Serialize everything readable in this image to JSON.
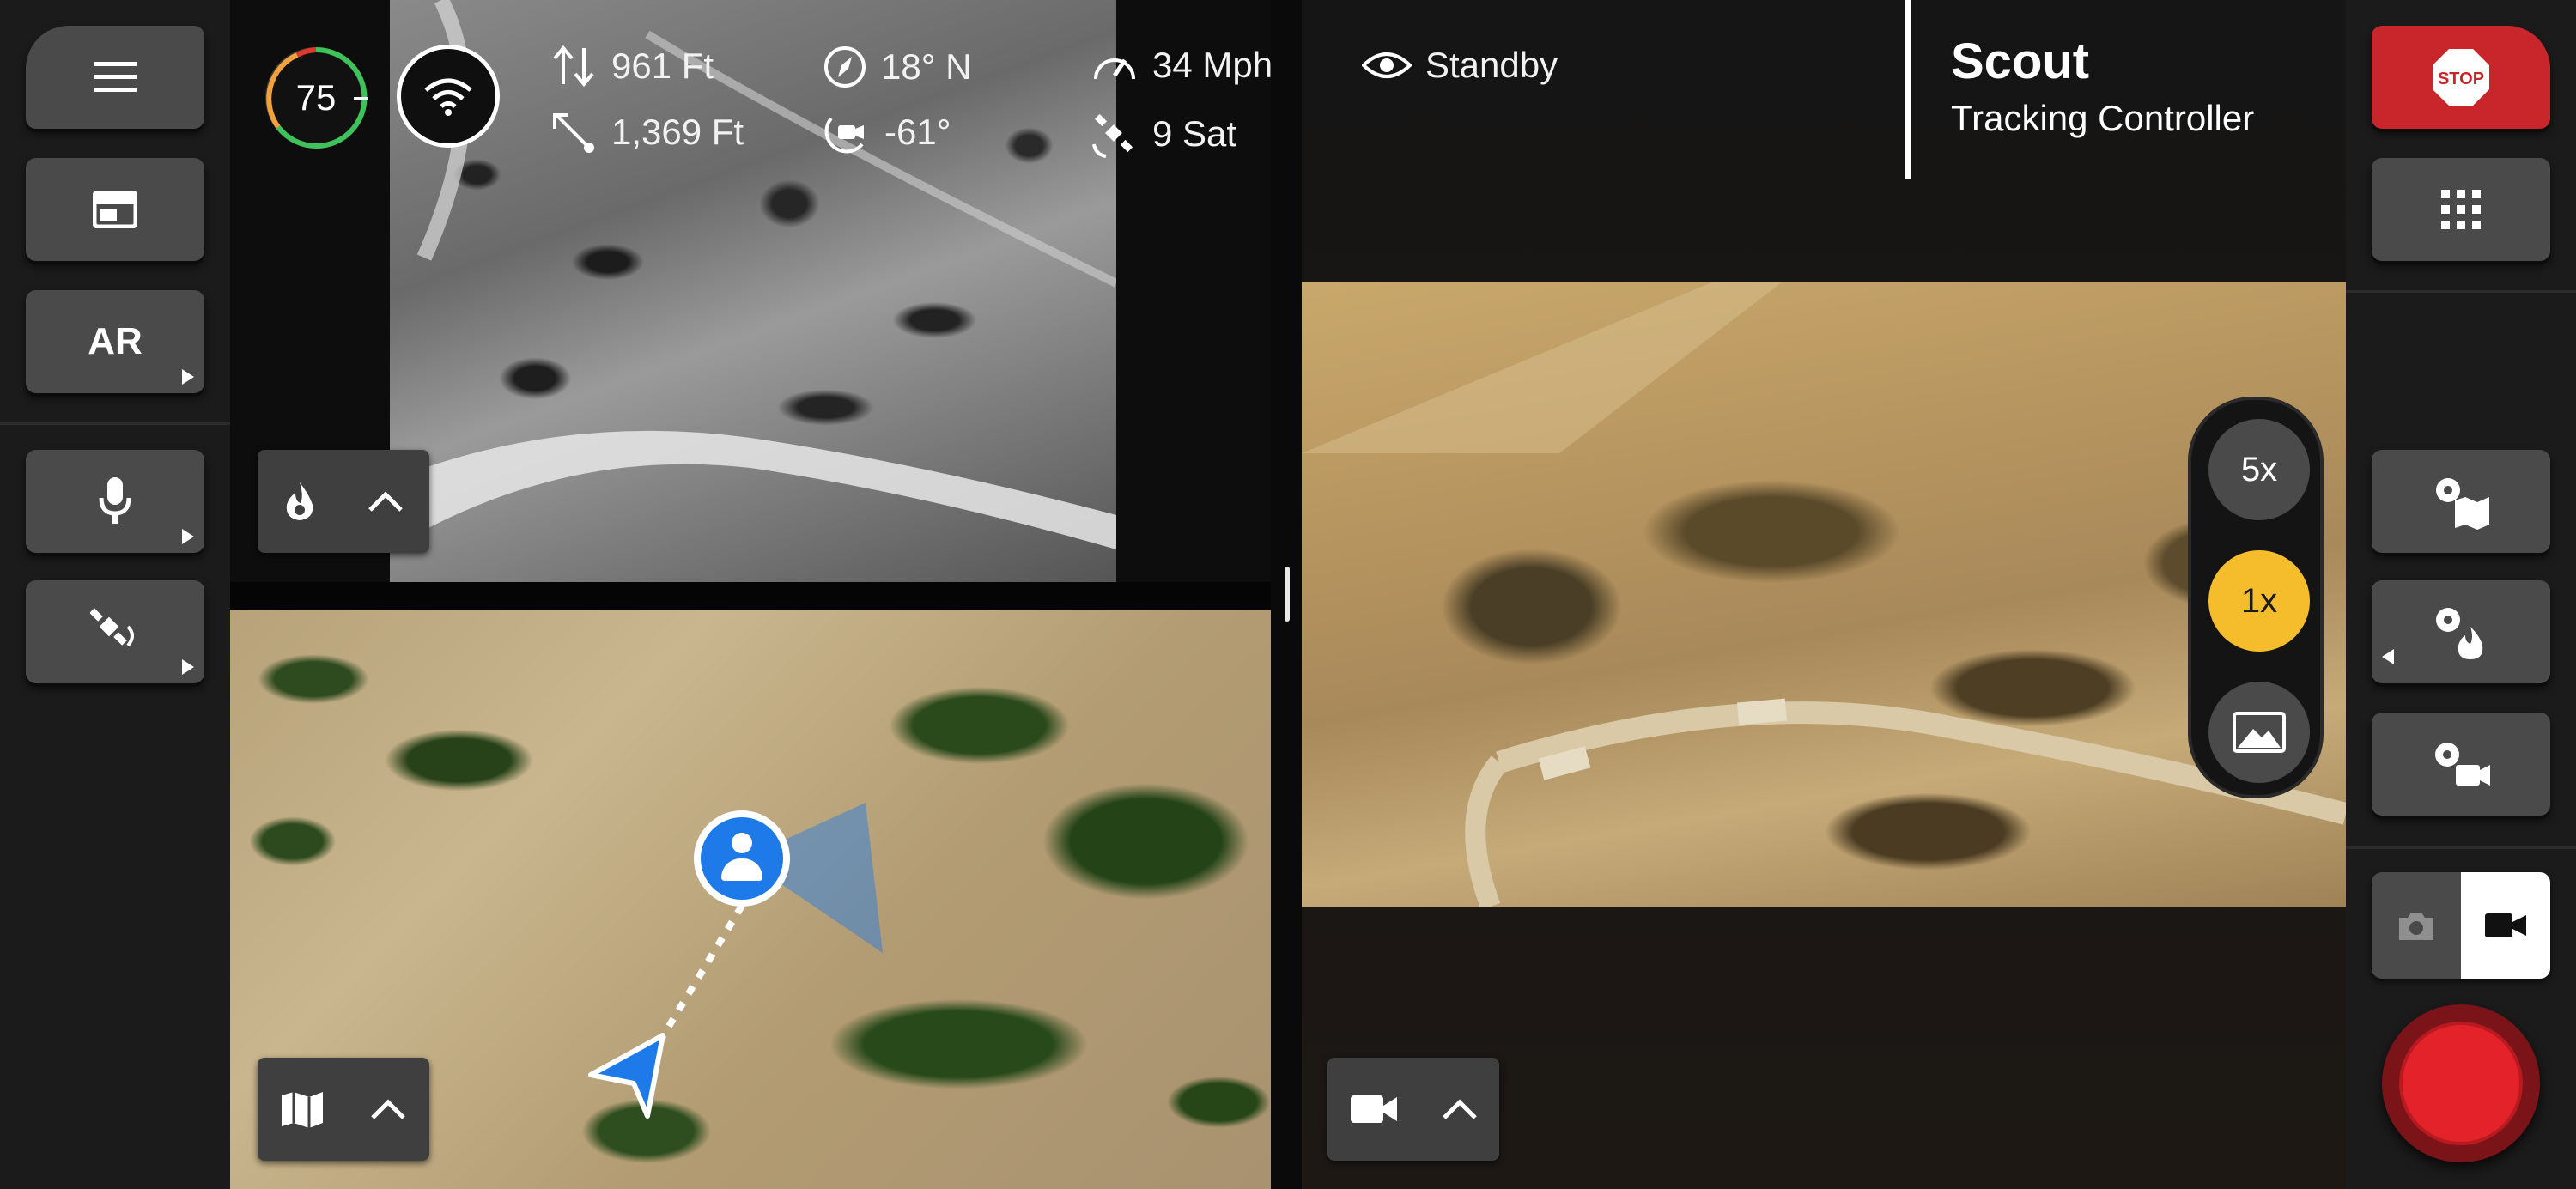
{
  "left_rail": {
    "menu_icon": "hamburger-menu-icon",
    "layout_icon": "layout-window-icon",
    "ar_label": "AR",
    "mic_icon": "microphone-icon",
    "satellite_icon": "satellite-icon"
  },
  "telemetry": {
    "battery": "75",
    "altitude": "961 Ft",
    "distance": "1,369 Ft",
    "heading": "18° N",
    "gimbal_pitch": "-61°",
    "speed": "34 Mph",
    "satellites": "9 Sat",
    "status": "Standby"
  },
  "header": {
    "title": "Scout",
    "subtitle": "Tracking Controller"
  },
  "zoom": {
    "option_5x": "5x",
    "option_1x": "1x",
    "active": "1x"
  },
  "right_rail": {
    "stop_label": "STOP",
    "grid_icon": "grid-apps-icon",
    "map_settings_icon": "map-settings-icon",
    "thermal_settings_icon": "thermal-settings-icon",
    "camera_settings_icon": "camera-settings-icon",
    "photo_mode_icon": "photo-camera-icon",
    "video_mode_icon": "video-camera-icon",
    "active_mode": "video"
  },
  "panels": {
    "thermal_toggle_icon": "flame-icon",
    "map_toggle_icon": "map-icon",
    "video_toggle_icon": "video-camera-icon"
  },
  "colors": {
    "stop_red": "#c8262b",
    "record_red": "#e4222a",
    "zoom_active": "#f5bd2b",
    "battery_green": "#3ec25a",
    "map_blue": "#1e7ae8"
  }
}
